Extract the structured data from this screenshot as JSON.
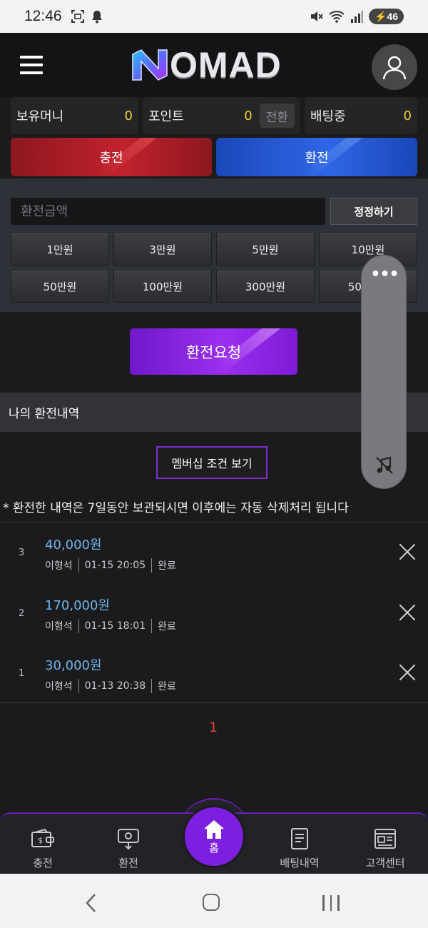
{
  "status_bar": {
    "time": "12:46",
    "battery": "46"
  },
  "header": {
    "logo_first": "N",
    "logo_rest": "OMAD"
  },
  "balances": [
    {
      "label": "보유머니",
      "value": "0"
    },
    {
      "label": "포인트",
      "value": "0",
      "button": "전환"
    },
    {
      "label": "배팅중",
      "value": "0"
    }
  ],
  "actions": {
    "charge": "충전",
    "exchange": "환전"
  },
  "form": {
    "amount_placeholder": "환전금액",
    "reset_label": "정정하기",
    "amounts": [
      "1만원",
      "3만원",
      "5만원",
      "10만원",
      "50만원",
      "100만원",
      "300만원",
      "500만원"
    ]
  },
  "request_label": "환전요청",
  "history": {
    "title": "나의 환전내역",
    "membership_label": "멤버십 조건 보기",
    "notice": "* 환전한 내역은 7일동안 보관되시면 이후에는 자동 삭제처리 됩니다",
    "rows": [
      {
        "num": "3",
        "amount": "40,000원",
        "name": "이형석",
        "date": "01-15 20:05",
        "status": "완료"
      },
      {
        "num": "2",
        "amount": "170,000원",
        "name": "이형석",
        "date": "01-15 18:01",
        "status": "완료"
      },
      {
        "num": "1",
        "amount": "30,000원",
        "name": "이형석",
        "date": "01-13 20:38",
        "status": "완료"
      }
    ],
    "page": "1"
  },
  "overlay": {
    "dots": "•••"
  },
  "bottom_nav": {
    "charge": "충전",
    "exchange": "환전",
    "home": "홈",
    "bet_history": "배팅내역",
    "support": "고객센터"
  },
  "colors": {
    "accent": "#7d1fe0",
    "amount_blue": "#6fb6e8",
    "balance_yellow": "#f2d43a",
    "page_red": "#e4473b"
  }
}
